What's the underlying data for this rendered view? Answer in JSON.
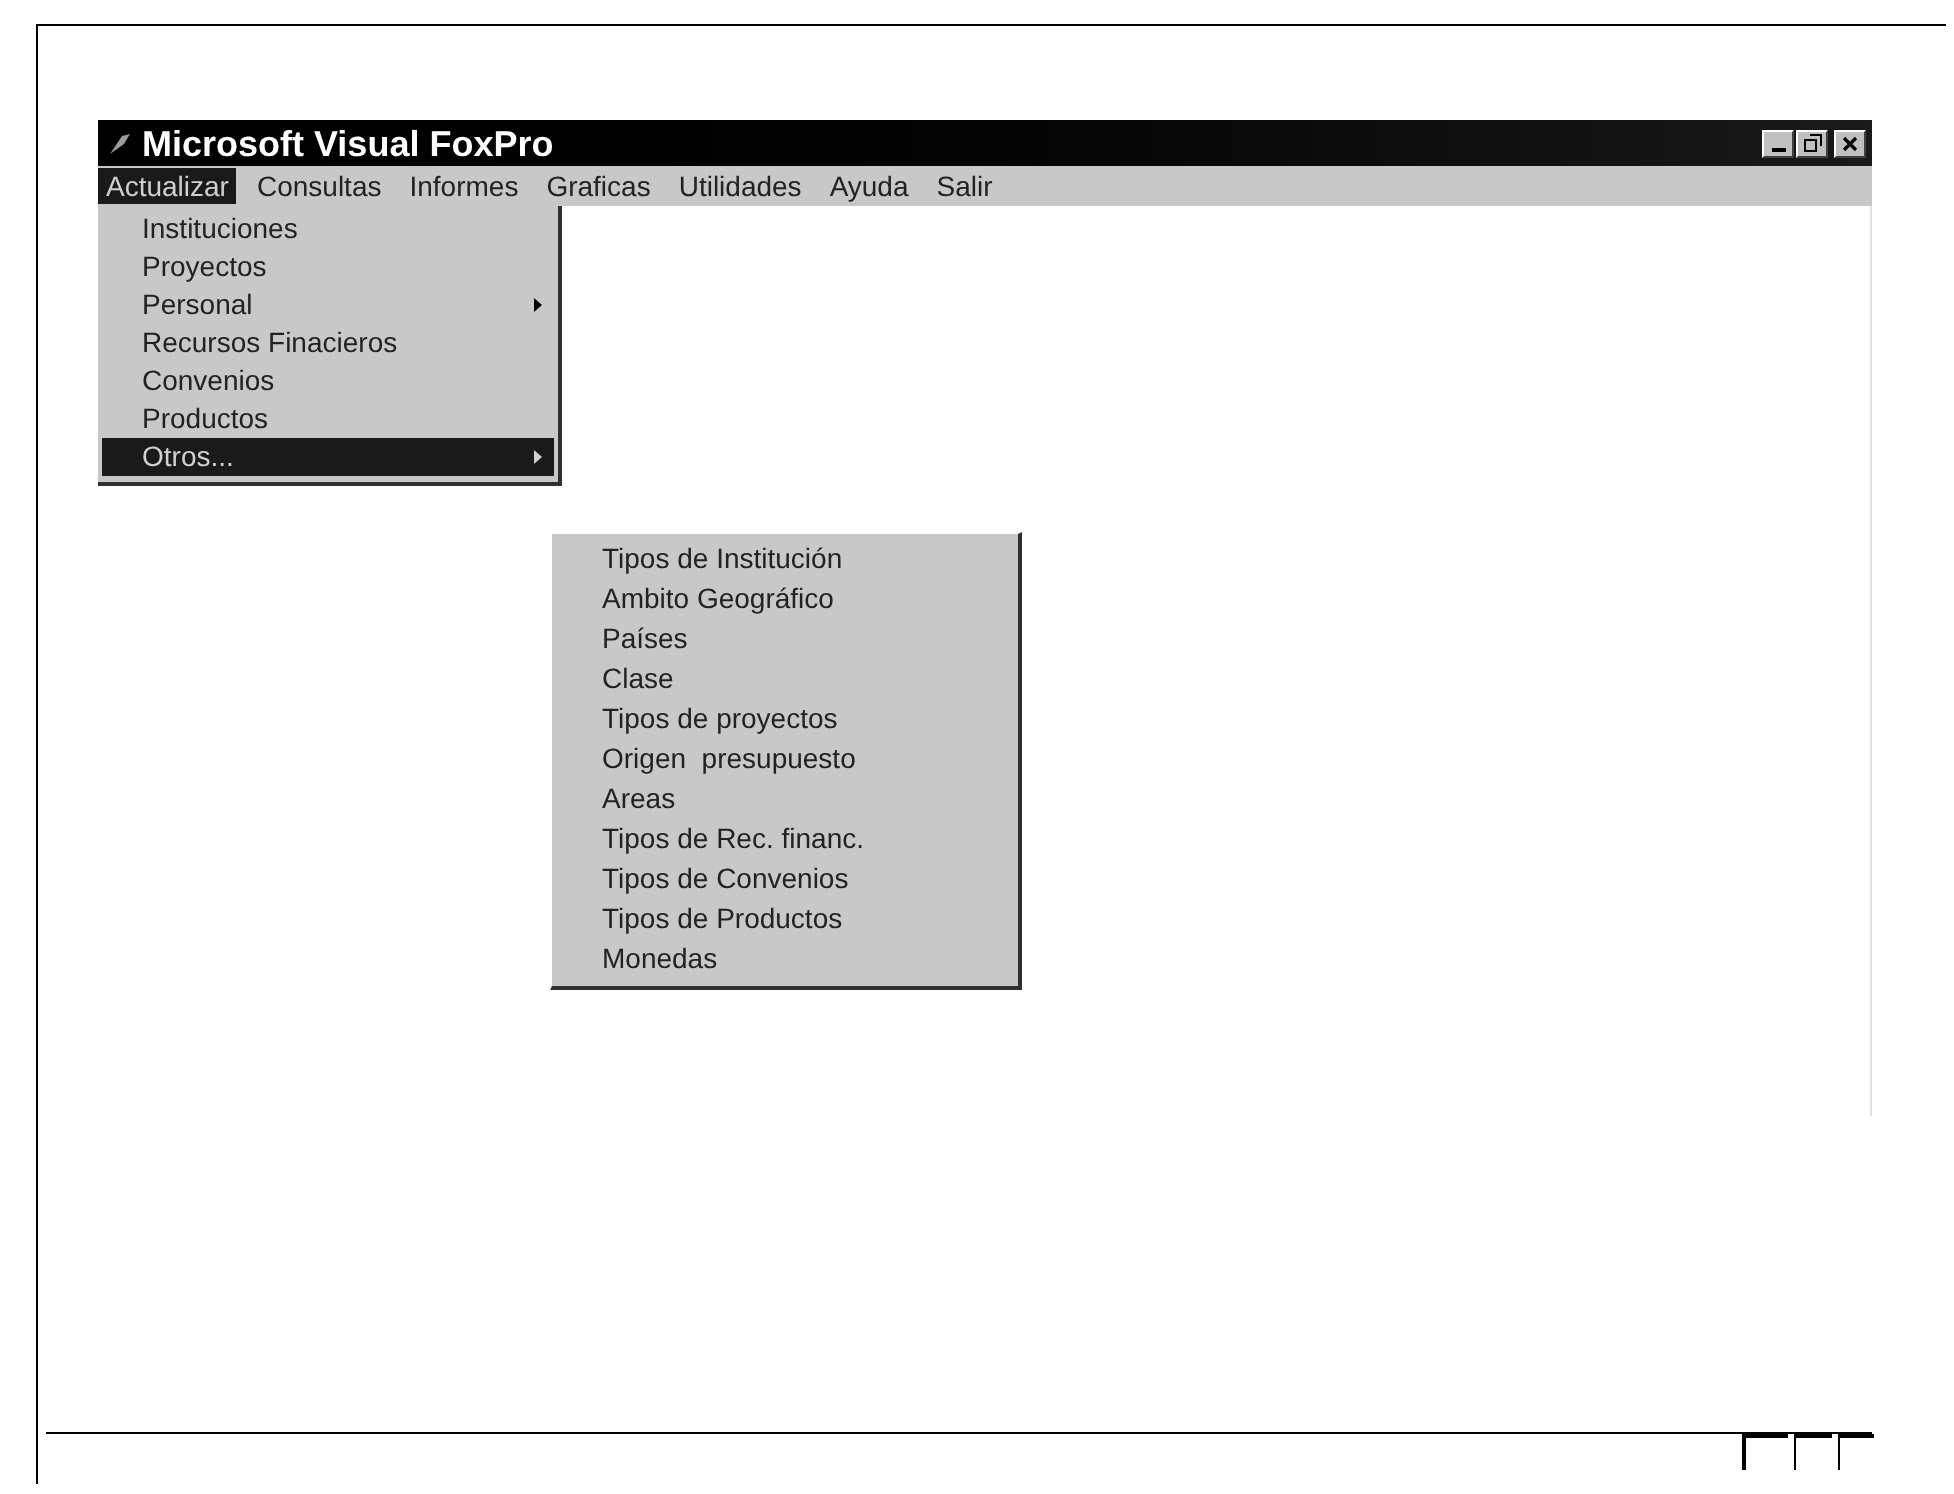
{
  "window": {
    "title": "Microsoft Visual FoxPro"
  },
  "menu_bar": [
    {
      "label": "Actualizar",
      "selected": true
    },
    {
      "label": "Consultas",
      "selected": false
    },
    {
      "label": "Informes",
      "selected": false
    },
    {
      "label": "Graficas",
      "selected": false
    },
    {
      "label": "Utilidades",
      "selected": false
    },
    {
      "label": "Ayuda",
      "selected": false
    },
    {
      "label": "Salir",
      "selected": false
    }
  ],
  "dropdown": [
    {
      "label": "Instituciones",
      "submenu": false,
      "selected": false
    },
    {
      "label": "Proyectos",
      "submenu": false,
      "selected": false
    },
    {
      "label": "Personal",
      "submenu": true,
      "selected": false
    },
    {
      "label": "Recursos Finacieros",
      "submenu": false,
      "selected": false
    },
    {
      "label": "Convenios",
      "submenu": false,
      "selected": false
    },
    {
      "label": "Productos",
      "submenu": false,
      "selected": false
    },
    {
      "label": "Otros...",
      "submenu": true,
      "selected": true
    }
  ],
  "submenu": [
    {
      "label": "Tipos de Institución"
    },
    {
      "label": "Ambito Geográfico"
    },
    {
      "label": "Países"
    },
    {
      "label": "Clase"
    },
    {
      "label": "Tipos de proyectos"
    },
    {
      "label": "Origen  presupuesto"
    },
    {
      "label": "Areas"
    },
    {
      "label": "Tipos de Rec. financ."
    },
    {
      "label": "Tipos de Convenios"
    },
    {
      "label": "Tipos de Productos"
    },
    {
      "label": "Monedas"
    }
  ]
}
